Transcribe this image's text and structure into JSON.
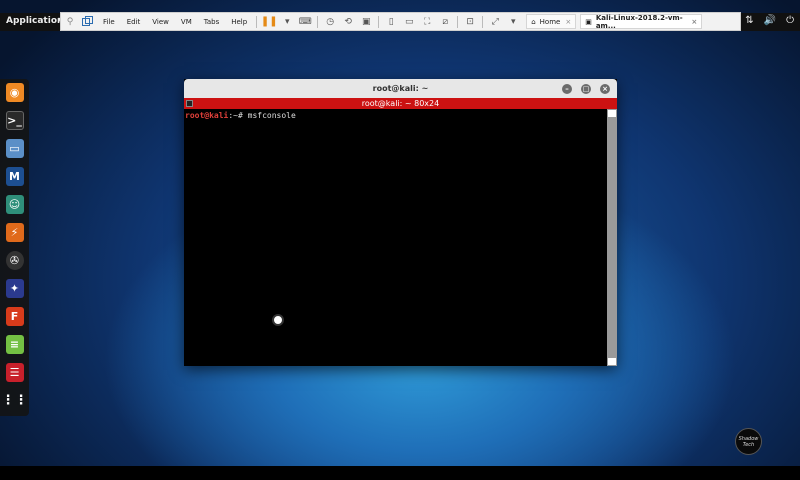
{
  "top_panel": {
    "applications_label": "Applications",
    "tray_icons": [
      "pen-icon",
      "network-icon",
      "volume-icon",
      "power-icon"
    ]
  },
  "vmware": {
    "menus": [
      "File",
      "Edit",
      "View",
      "VM",
      "Tabs",
      "Help"
    ],
    "tabs": [
      {
        "label": "Home"
      },
      {
        "label": "Kali-Linux-2018.2-vm-am..."
      }
    ]
  },
  "dock": {
    "items": [
      {
        "name": "firefox",
        "color": "#f08a24"
      },
      {
        "name": "terminal",
        "color": "#2a2a2a"
      },
      {
        "name": "files",
        "color": "#5b8fc7"
      },
      {
        "name": "metasploit",
        "color": "#1d4f91"
      },
      {
        "name": "armitage",
        "color": "#2f8f7a"
      },
      {
        "name": "burpsuite",
        "color": "#e06a1b"
      },
      {
        "name": "beef",
        "color": "#333333"
      },
      {
        "name": "maltego",
        "color": "#2b3a8f"
      },
      {
        "name": "faraday",
        "color": "#d83b1b"
      },
      {
        "name": "leafpad",
        "color": "#74c043"
      },
      {
        "name": "cherrytree",
        "color": "#c8202b"
      },
      {
        "name": "show-apps",
        "color": "#2a2a2a"
      }
    ]
  },
  "terminal": {
    "window_title": "root@kali: ~",
    "tab_title": "root@kali: ~ 80x24",
    "prompt_user": "root@kali",
    "prompt_path": ":~#",
    "command": "msfconsole"
  },
  "watermark": {
    "line1": "Shadow",
    "line2": "Tech"
  }
}
